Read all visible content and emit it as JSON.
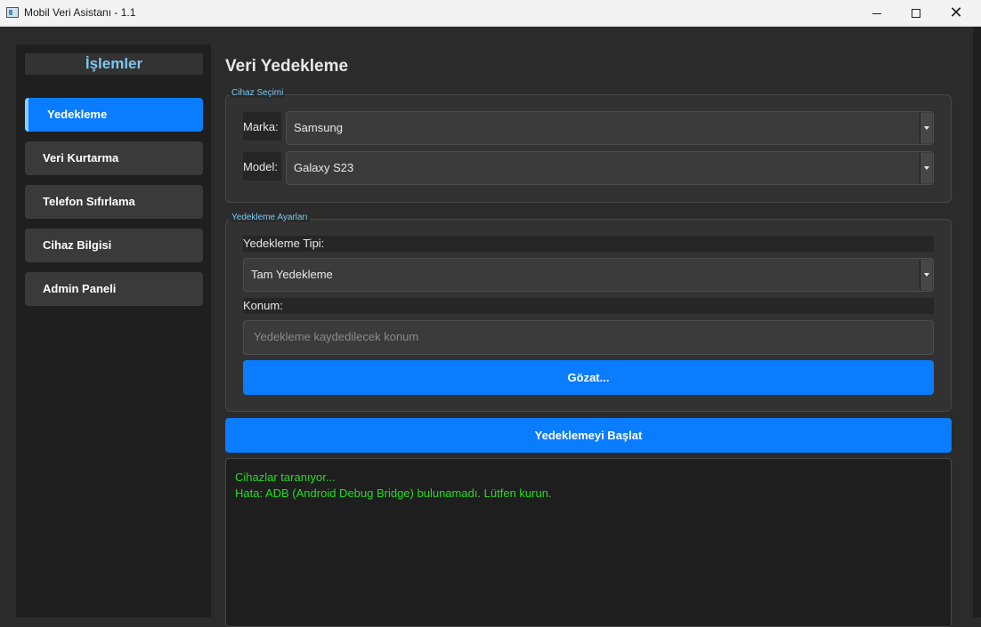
{
  "window": {
    "title": "Mobil Veri Asistanı - 1.1",
    "controls": {
      "minimize": "minimize-icon",
      "maximize": "maximize-icon",
      "close": "✕"
    }
  },
  "sidebar": {
    "title": "İşlemler",
    "items": [
      {
        "label": "Yedekleme",
        "active": true
      },
      {
        "label": "Veri Kurtarma",
        "active": false
      },
      {
        "label": "Telefon Sıfırlama",
        "active": false
      },
      {
        "label": "Cihaz Bilgisi",
        "active": false
      },
      {
        "label": "Admin Paneli",
        "active": false
      }
    ]
  },
  "main": {
    "title": "Veri Yedekleme",
    "device_group": {
      "title": "Cihaz Seçimi",
      "brand_label": "Marka:",
      "brand_value": "Samsung",
      "model_label": "Model:",
      "model_value": "Galaxy S23"
    },
    "backup_group": {
      "title": "Yedekleme Ayarları",
      "type_label": "Yedekleme Tipi:",
      "type_value": "Tam Yedekleme",
      "location_label": "Konum:",
      "location_placeholder": "Yedekleme kaydedilecek konum",
      "browse_label": "Gözat..."
    },
    "start_label": "Yedeklemeyi Başlat",
    "log_lines": [
      "Cihazlar taranıyor...",
      "Hata: ADB (Android Debug Bridge) bulunamadı. Lütfen kurun."
    ]
  },
  "colors": {
    "accent": "#0a7cff",
    "sidebar_title": "#7cc6ef",
    "log_text": "#22dd22",
    "background": "#2b2b2b"
  }
}
